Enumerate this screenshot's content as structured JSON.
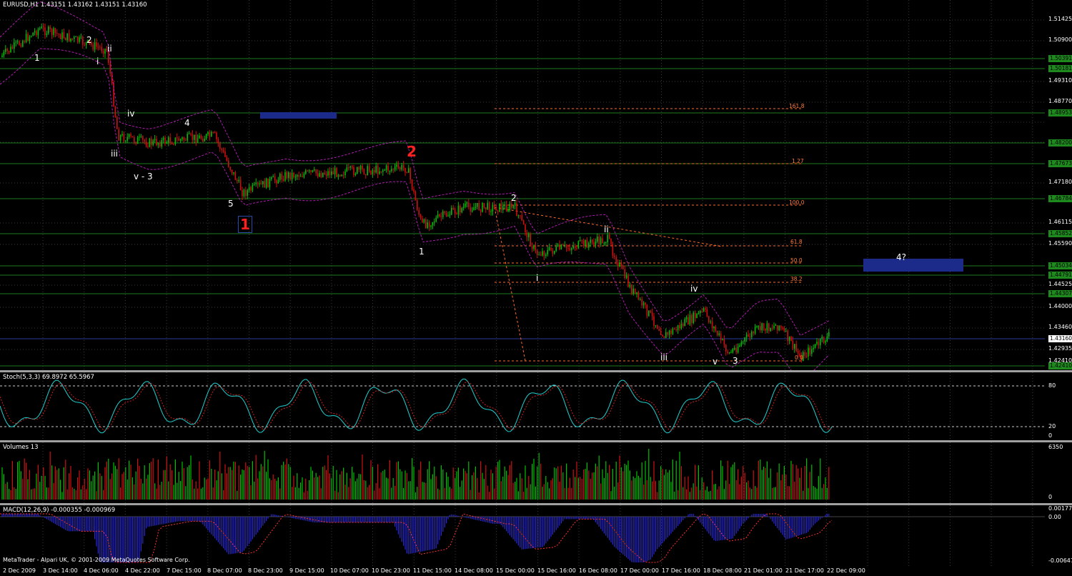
{
  "chart": {
    "title": "EURUSD,H1  1.43151 1.43162 1.43151 1.43160",
    "copyright": "MetaTrader - Alpari UK, © 2001-2009 MetaQuotes Software Corp.",
    "price_ticks": [
      "1.51425",
      "1.50900",
      "1.49310",
      "1.48770",
      "1.47180",
      "1.46115",
      "1.45590",
      "1.44525",
      "1.44000",
      "1.43460",
      "1.42935",
      "1.42410"
    ],
    "level_tags": [
      "1.50391",
      "1.50181",
      "1.48953",
      "1.48200",
      "1.47673",
      "1.46784",
      "1.45852",
      "1.45034",
      "1.44791",
      "1.44307",
      "1.42410"
    ],
    "current_price": "1.43160",
    "fib_labels": [
      "161.8",
      "1.27",
      "100.0",
      "61.8",
      "50.0",
      "38.2",
      "0.0"
    ],
    "wave_labels": [
      "1",
      "2",
      "ii",
      "i",
      "iv",
      "iii",
      "v - 3",
      "4",
      "5",
      "1",
      "2",
      "1",
      "2",
      "i",
      "ii",
      "iv",
      "iii",
      "v",
      "3",
      "4?"
    ],
    "colors": {
      "up": "#00c000",
      "down": "#d01010",
      "grid": "#3a3a3a",
      "level": "#1e7a1e",
      "fib": "#ff6a2a",
      "band": "#b01cb0",
      "zone": "#1c2a8a"
    }
  },
  "stoch": {
    "label": "Stoch(5,3,3) 69.8972 65.5967",
    "ticks": [
      "80",
      "20",
      "0"
    ]
  },
  "volume": {
    "label": "Volumes 13",
    "ticks": [
      "6350",
      "0"
    ]
  },
  "macd": {
    "label": "MACD(12,26,9) -0.000355 -0.000969",
    "ticks": [
      "0.00177",
      "0.00",
      "-0.00647"
    ]
  },
  "time_axis": [
    "2 Dec 2009",
    "3 Dec 14:00",
    "4 Dec 06:00",
    "4 Dec 22:00",
    "7 Dec 15:00",
    "8 Dec 07:00",
    "8 Dec 23:00",
    "9 Dec 15:00",
    "10 Dec 07:00",
    "10 Dec 23:00",
    "11 Dec 15:00",
    "14 Dec 08:00",
    "15 Dec 00:00",
    "15 Dec 16:00",
    "16 Dec 08:00",
    "17 Dec 00:00",
    "17 Dec 16:00",
    "18 Dec 08:00",
    "21 Dec 01:00",
    "21 Dec 17:00",
    "22 Dec 09:00"
  ]
}
